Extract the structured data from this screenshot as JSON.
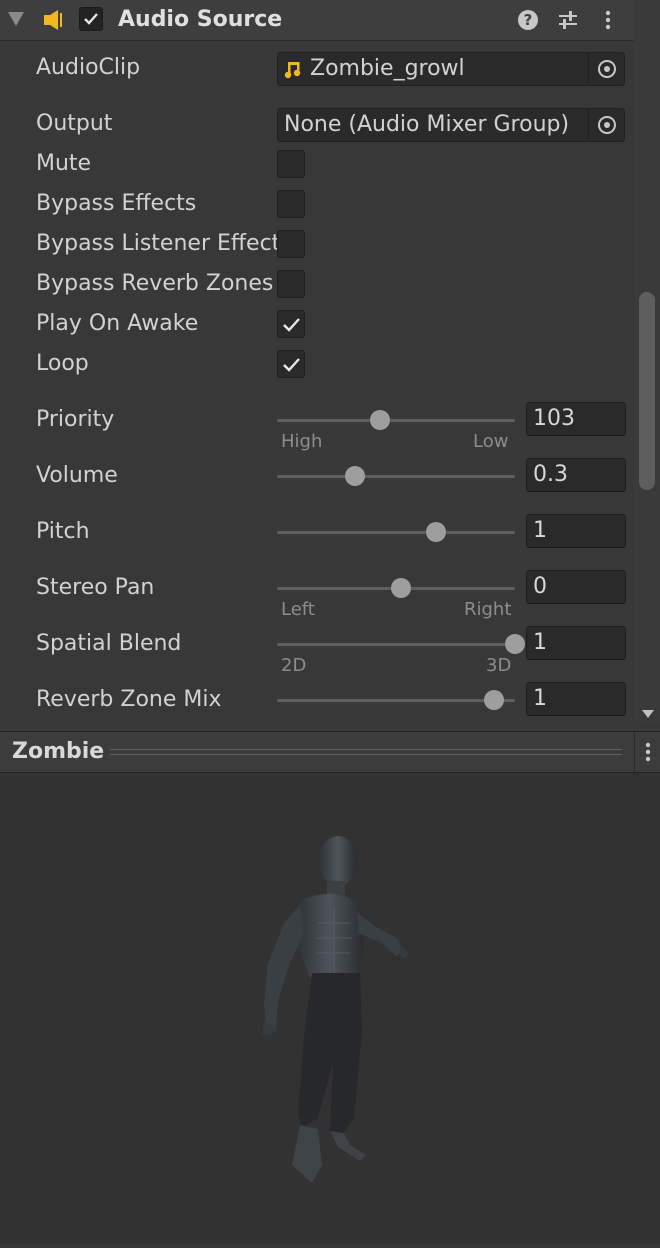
{
  "component": {
    "title": "Audio Source",
    "enabled": true,
    "icons": {
      "foldout": "foldout-expanded-icon",
      "component": "audio-speaker-icon",
      "help": "help-icon",
      "presets": "presets-sliders-icon",
      "menu": "kebab-menu-icon"
    }
  },
  "fields": {
    "audioclip": {
      "label": "AudioClip",
      "value": "Zombie_growl",
      "icon": "audio-clip-icon"
    },
    "output": {
      "label": "Output",
      "value": "None (Audio Mixer Group)"
    },
    "mute": {
      "label": "Mute",
      "checked": false
    },
    "bypass_effects": {
      "label": "Bypass Effects",
      "checked": false
    },
    "bypass_listener": {
      "label": "Bypass Listener Effects",
      "checked": false
    },
    "bypass_reverb": {
      "label": "Bypass Reverb Zones",
      "checked": false
    },
    "play_on_awake": {
      "label": "Play On Awake",
      "checked": true
    },
    "loop": {
      "label": "Loop",
      "checked": true
    },
    "priority": {
      "label": "Priority",
      "value": "103",
      "min_label": "High",
      "max_label": "Low",
      "fraction": 0.41
    },
    "volume": {
      "label": "Volume",
      "value": "0.3",
      "fraction": 0.3
    },
    "pitch": {
      "label": "Pitch",
      "value": "1",
      "fraction": 0.655
    },
    "stereo_pan": {
      "label": "Stereo Pan",
      "value": "0",
      "min_label": "Left",
      "max_label": "Right",
      "fraction": 0.5
    },
    "spatial_blend": {
      "label": "Spatial Blend",
      "value": "1",
      "min_label": "2D",
      "max_label": "3D",
      "fraction": 1.0
    },
    "reverb_zone_mix": {
      "label": "Reverb Zone Mix",
      "value": "1",
      "fraction": 0.91
    }
  },
  "preview": {
    "title": "Zombie",
    "menu_icon": "kebab-menu-icon",
    "subject": "zombie-model"
  },
  "colors": {
    "panel": "#383838",
    "field": "#2a2a2a",
    "accent_clip": "#f2b91f",
    "knob": "#9e9e9e"
  }
}
